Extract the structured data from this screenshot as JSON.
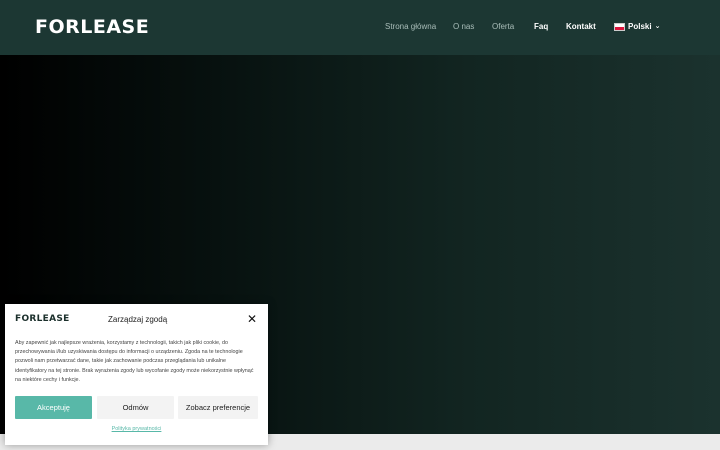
{
  "header": {
    "logo": "FORLEASE",
    "nav": [
      {
        "label": "Strona główna"
      },
      {
        "label": "O nas"
      },
      {
        "label": "Oferta"
      },
      {
        "label": "Faq"
      },
      {
        "label": "Kontakt"
      }
    ],
    "language": {
      "label": "Polski",
      "icon": "chevron-down-icon"
    }
  },
  "consent": {
    "logo": "FORLEASE",
    "title": "Zarządzaj zgodą",
    "close_icon": "close-icon",
    "text": "Aby zapewnić jak najlepsze wrażenia, korzystamy z technologii, takich jak pliki cookie, do przechowywania i/lub uzyskiwania dostępu do informacji o urządzeniu. Zgoda na te technologie pozwoli nam przetwarzać dane, takie jak zachowanie podczas przeglądania lub unikalne identyfikatory na tej stronie. Brak wyrażenia zgody lub wycofanie zgody może niekorzystnie wpłynąć na niektóre cechy i funkcje.",
    "accept_label": "Akceptuję",
    "deny_label": "Odmów",
    "prefs_label": "Zobacz preferencje",
    "policy_label": "Polityka prywatności"
  },
  "colors": {
    "header_bg": "#1c3733",
    "accent": "#58b8a8"
  }
}
